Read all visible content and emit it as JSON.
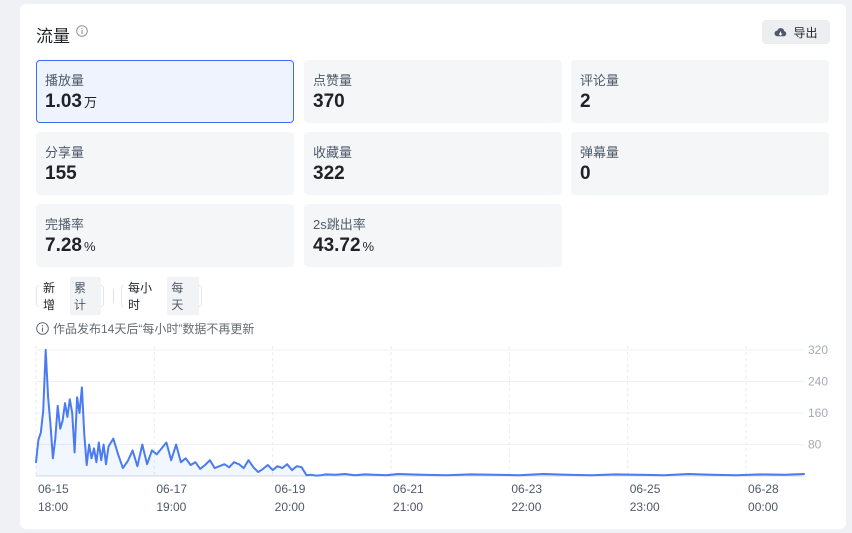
{
  "header": {
    "title": "流量",
    "export_label": "导出"
  },
  "metrics": [
    {
      "label": "播放量",
      "value": "1.03",
      "unit": "万"
    },
    {
      "label": "点赞量",
      "value": "370",
      "unit": ""
    },
    {
      "label": "评论量",
      "value": "2",
      "unit": ""
    },
    {
      "label": "分享量",
      "value": "155",
      "unit": ""
    },
    {
      "label": "收藏量",
      "value": "322",
      "unit": ""
    },
    {
      "label": "弹幕量",
      "value": "0",
      "unit": ""
    },
    {
      "label": "完播率",
      "value": "7.28",
      "unit": "%"
    },
    {
      "label": "2s跳出率",
      "value": "43.72",
      "unit": "%"
    }
  ],
  "toggles": {
    "mode": [
      "新增",
      "累计"
    ],
    "granularity": [
      "每小时",
      "每天"
    ]
  },
  "note": "作品发布14天后“每小时”数据不再更新",
  "colors": {
    "accent": "#3f6df4",
    "line": "#4a7cf0"
  },
  "chart_data": {
    "type": "area",
    "ylim": [
      0,
      330
    ],
    "yticks": [
      80,
      160,
      240,
      320
    ],
    "xticks": [
      {
        "date": "06-15",
        "time": "18:00"
      },
      {
        "date": "06-17",
        "time": "19:00"
      },
      {
        "date": "06-19",
        "time": "20:00"
      },
      {
        "date": "06-21",
        "time": "21:00"
      },
      {
        "date": "06-23",
        "time": "22:00"
      },
      {
        "date": "06-25",
        "time": "23:00"
      },
      {
        "date": "06-28",
        "time": "00:00"
      }
    ],
    "x_range_hours": [
      0,
      318
    ],
    "tick_hours": [
      0,
      49,
      98,
      147,
      196,
      245,
      294
    ],
    "series": [
      {
        "x": [
          0,
          1,
          2,
          3,
          4,
          5,
          6,
          7,
          8,
          9,
          10,
          11,
          12,
          13,
          14,
          15,
          16,
          17,
          18,
          19,
          20,
          21,
          22,
          23,
          24,
          25,
          26,
          27,
          28,
          29,
          30,
          32,
          34,
          36,
          38,
          40,
          42,
          44,
          46,
          48,
          50,
          52,
          54,
          56,
          58,
          60,
          62,
          64,
          66,
          68,
          70,
          72,
          74,
          76,
          78,
          80,
          82,
          84,
          86,
          88,
          90,
          92,
          94,
          96,
          98,
          100,
          102,
          104,
          106,
          108,
          110,
          112,
          114,
          116,
          118,
          120,
          124,
          128,
          132,
          136,
          140,
          145,
          150,
          160,
          170,
          180,
          190,
          200,
          210,
          220,
          230,
          240,
          250,
          260,
          270,
          280,
          290,
          300,
          310,
          318
        ],
        "y": [
          35,
          92,
          110,
          165,
          320,
          200,
          130,
          45,
          95,
          178,
          120,
          140,
          185,
          150,
          195,
          160,
          60,
          200,
          160,
          225,
          105,
          28,
          80,
          45,
          70,
          35,
          85,
          40,
          80,
          30,
          75,
          95,
          55,
          20,
          38,
          65,
          25,
          80,
          30,
          65,
          55,
          70,
          85,
          40,
          80,
          35,
          45,
          28,
          35,
          18,
          28,
          40,
          20,
          25,
          30,
          22,
          35,
          30,
          20,
          40,
          22,
          10,
          18,
          28,
          15,
          25,
          20,
          30,
          15,
          25,
          22,
          2,
          3,
          1,
          2,
          4,
          3,
          5,
          2,
          4,
          3,
          2,
          5,
          3,
          2,
          4,
          3,
          2,
          5,
          3,
          2,
          4,
          3,
          2,
          5,
          3,
          2,
          4,
          3,
          5
        ]
      }
    ]
  }
}
